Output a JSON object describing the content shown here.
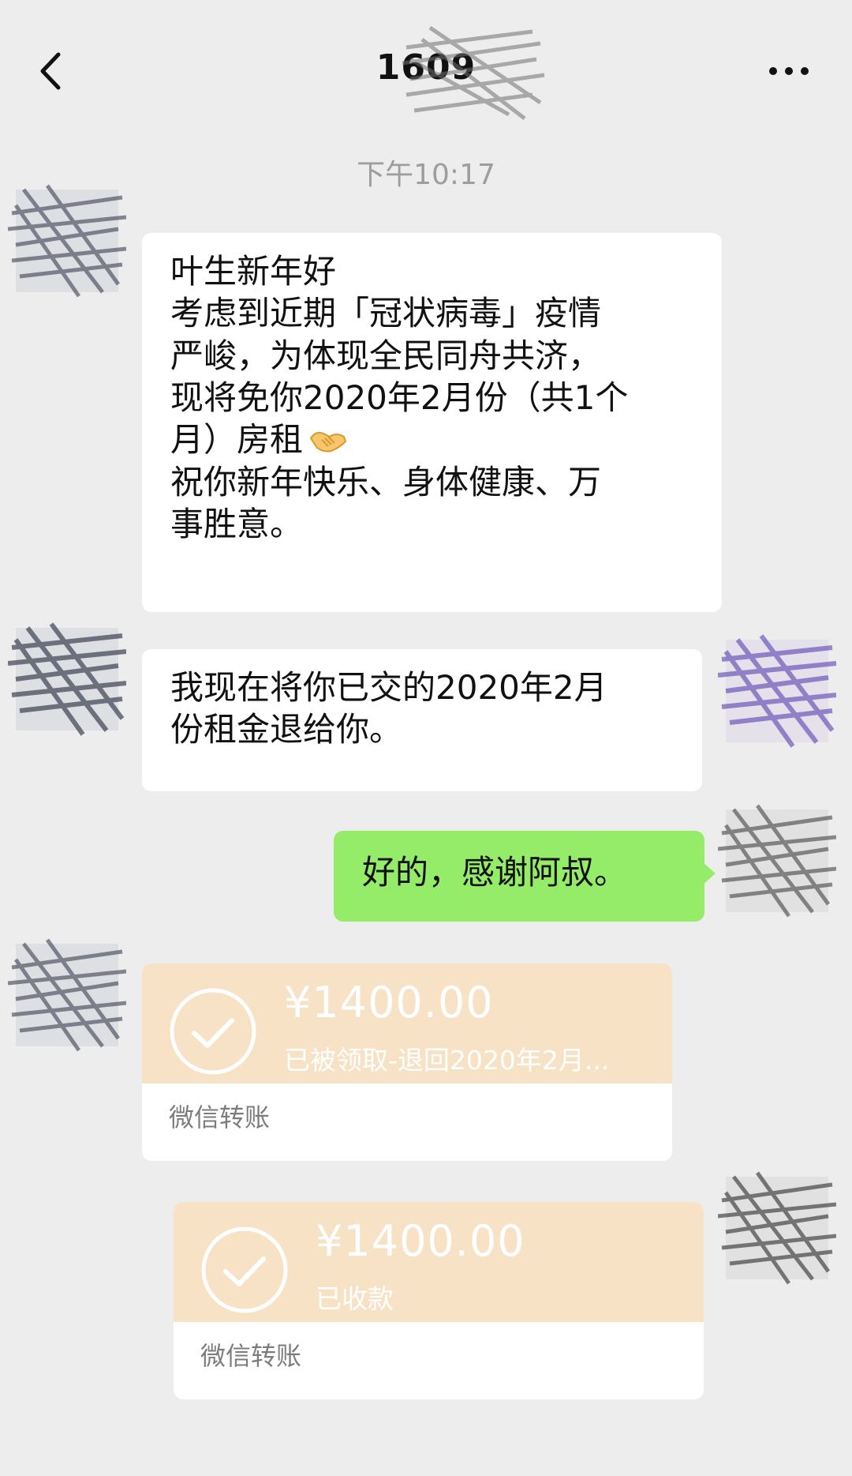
{
  "header": {
    "title": "1609"
  },
  "timestamp": "下午10:17",
  "messages": {
    "greeting": {
      "lines": [
        "叶生新年好",
        "考虑到近期「冠状病毒」疫情",
        "严峻，为体现全民同舟共济，",
        "现将免你2020年2月份（共1个",
        "月）房租",
        "祝你新年快乐、身体健康、万",
        "事胜意。"
      ],
      "emoji": "handshake-emoji"
    },
    "refund": {
      "lines": [
        "我现在将你已交的2020年2月",
        "份租金退给你。"
      ]
    },
    "reply": {
      "lines": [
        "好的，感谢阿叔。"
      ]
    }
  },
  "transfers": [
    {
      "amount": "¥1400.00",
      "status": "已被领取-退回2020年2月...",
      "label": "微信转账"
    },
    {
      "amount": "¥1400.00",
      "status": "已收款",
      "label": "微信转账"
    }
  ],
  "colors": {
    "background": "#ededed",
    "incoming_bubble": "#ffffff",
    "outgoing_bubble": "#95ec69",
    "transfer_card": "#f8e2c6",
    "timestamp_text": "#9d9d9d"
  },
  "icons": {
    "back": "chevron-left-icon",
    "more": "more-dots-icon",
    "transfer_check": "check-circle-icon"
  }
}
